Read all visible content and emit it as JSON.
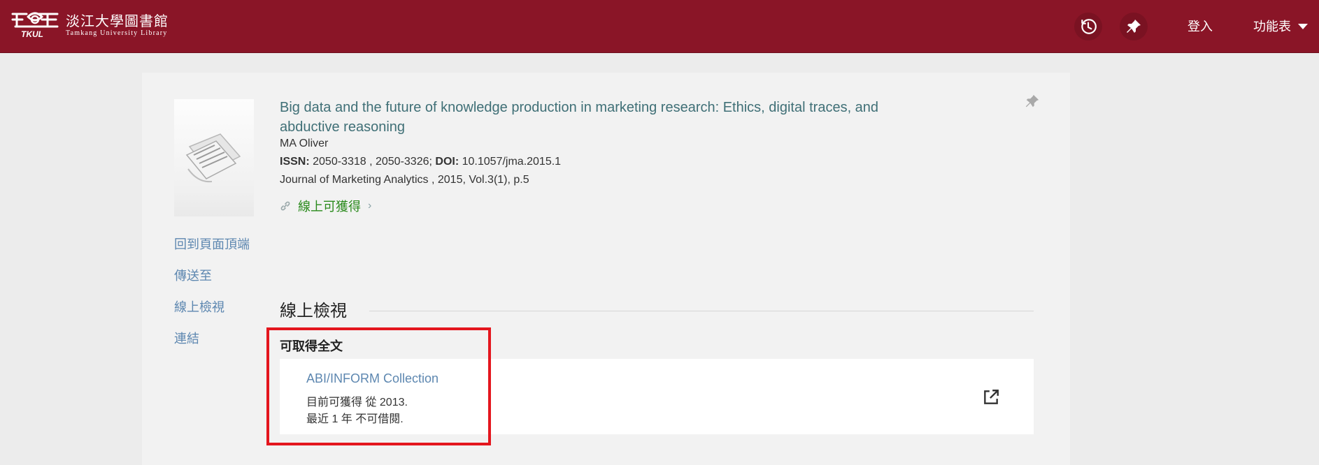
{
  "header": {
    "logo_cn": "淡江大學圖書館",
    "logo_en": "Tamkang University Library",
    "logo_mark": "TKUL",
    "history_icon": "history-icon",
    "pin_icon": "pin-icon",
    "login_label": "登入",
    "menu_label": "功能表",
    "brand_color": "#8a1527"
  },
  "record": {
    "title": "Big data and the future of knowledge production in marketing research: Ethics, digital traces, and abductive reasoning",
    "author": "MA Oliver",
    "issn_label": "ISSN:",
    "issn_value": "2050-3318 , 2050-3326;",
    "doi_label": "DOI:",
    "doi_value": "10.1057/jma.2015.1",
    "source": "Journal of Marketing Analytics , 2015, Vol.3(1), p.5",
    "availability": "線上可獲得",
    "availability_color": "#2a8a1c"
  },
  "side_nav": {
    "items": [
      {
        "label": "回到頁面頂端"
      },
      {
        "label": "傳送至"
      },
      {
        "label": "線上檢視"
      },
      {
        "label": "連結"
      }
    ]
  },
  "online_view": {
    "title": "線上檢視",
    "subtitle": "可取得全文",
    "service": {
      "name": "ABI/INFORM Collection",
      "coverage": "目前可獲得 從 2013.",
      "embargo": "最近 1 年 不可借閱."
    }
  },
  "highlight_color": "#e4161e"
}
